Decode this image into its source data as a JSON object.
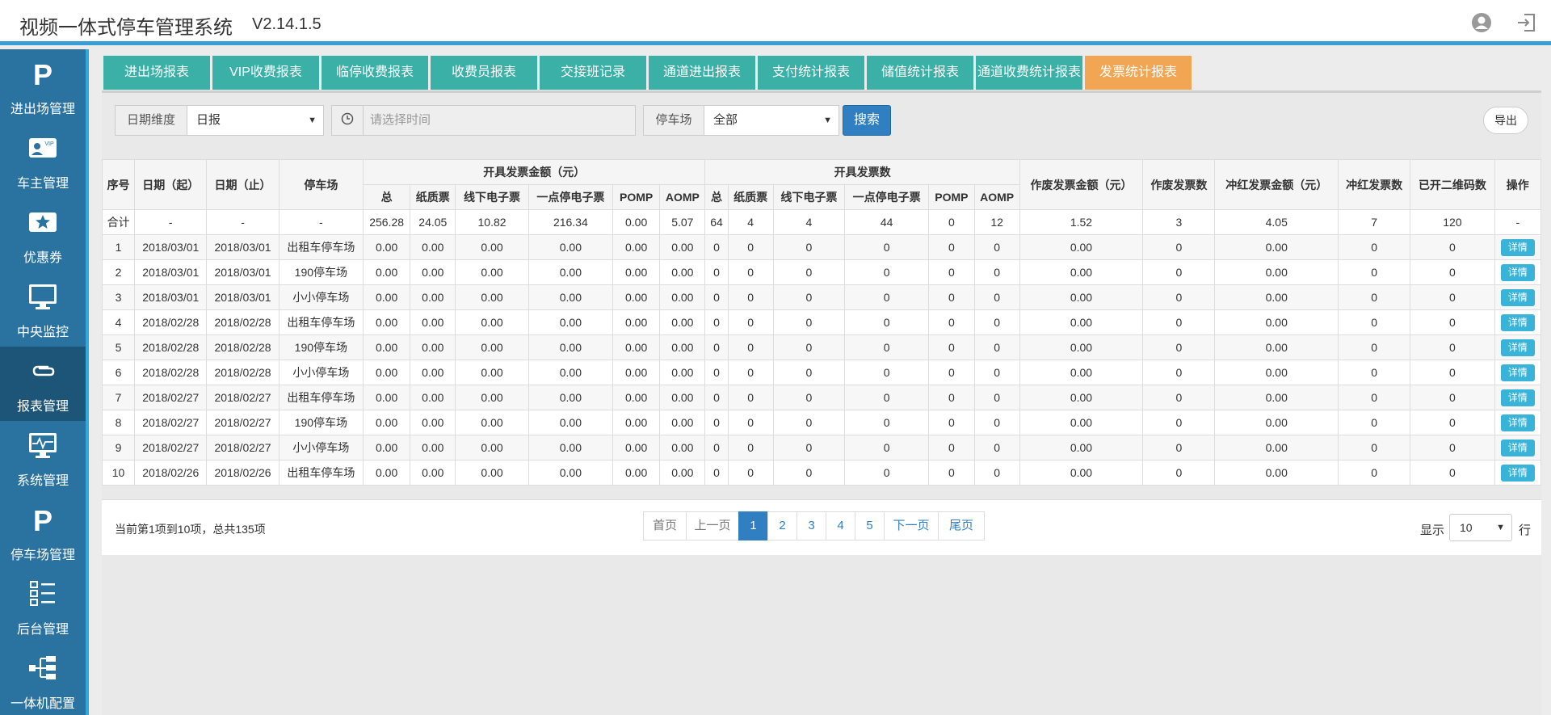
{
  "app": {
    "title": "视频一体式停车管理系统",
    "version": "V2.14.1.5"
  },
  "sidebar": {
    "items": [
      {
        "label": "进出场管理",
        "icon": "parking-icon"
      },
      {
        "label": "车主管理",
        "icon": "vip-card-icon"
      },
      {
        "label": "优惠券",
        "icon": "coupon-icon"
      },
      {
        "label": "中央监控",
        "icon": "monitor-icon"
      },
      {
        "label": "报表管理",
        "icon": "paperclip-icon",
        "active": true
      },
      {
        "label": "系统管理",
        "icon": "system-monitor-icon"
      },
      {
        "label": "停车场管理",
        "icon": "parking-icon"
      },
      {
        "label": "后台管理",
        "icon": "list-icon"
      },
      {
        "label": "一体机配置",
        "icon": "network-icon"
      }
    ]
  },
  "tabs": [
    {
      "label": "进出场报表"
    },
    {
      "label": "VIP收费报表"
    },
    {
      "label": "临停收费报表"
    },
    {
      "label": "收费员报表"
    },
    {
      "label": "交接班记录"
    },
    {
      "label": "通道进出报表"
    },
    {
      "label": "支付统计报表"
    },
    {
      "label": "储值统计报表"
    },
    {
      "label": "通道收费统计报表"
    },
    {
      "label": "发票统计报表",
      "active": true
    }
  ],
  "filters": {
    "date_dim_label": "日期维度",
    "date_dim_value": "日报",
    "time_placeholder": "请选择时间",
    "lot_label": "停车场",
    "lot_value": "全部",
    "search_label": "搜索",
    "export_label": "导出"
  },
  "table": {
    "headers": {
      "index": "序号",
      "date_start": "日期（起）",
      "date_end": "日期（止）",
      "lot": "停车场",
      "amount_group": "开具发票金额（元）",
      "count_group": "开具发票数",
      "void_amount": "作废发票金额（元）",
      "void_count": "作废发票数",
      "red_amount": "冲红发票金额（元）",
      "red_count": "冲红发票数",
      "qr_count": "已开二维码数",
      "action": "操作"
    },
    "sub_headers": [
      "总",
      "纸质票",
      "线下电子票",
      "一点停电子票",
      "POMP",
      "AOMP"
    ],
    "total_row": [
      "合计",
      "-",
      "-",
      "-",
      "256.28",
      "24.05",
      "10.82",
      "216.34",
      "0.00",
      "5.07",
      "64",
      "4",
      "4",
      "44",
      "0",
      "12",
      "1.52",
      "3",
      "4.05",
      "7",
      "120",
      "-"
    ],
    "rows": [
      [
        "1",
        "2018/03/01",
        "2018/03/01",
        "出租车停车场",
        "0.00",
        "0.00",
        "0.00",
        "0.00",
        "0.00",
        "0.00",
        "0",
        "0",
        "0",
        "0",
        "0",
        "0",
        "0.00",
        "0",
        "0.00",
        "0",
        "0"
      ],
      [
        "2",
        "2018/03/01",
        "2018/03/01",
        "190停车场",
        "0.00",
        "0.00",
        "0.00",
        "0.00",
        "0.00",
        "0.00",
        "0",
        "0",
        "0",
        "0",
        "0",
        "0",
        "0.00",
        "0",
        "0.00",
        "0",
        "0"
      ],
      [
        "3",
        "2018/03/01",
        "2018/03/01",
        "小小停车场",
        "0.00",
        "0.00",
        "0.00",
        "0.00",
        "0.00",
        "0.00",
        "0",
        "0",
        "0",
        "0",
        "0",
        "0",
        "0.00",
        "0",
        "0.00",
        "0",
        "0"
      ],
      [
        "4",
        "2018/02/28",
        "2018/02/28",
        "出租车停车场",
        "0.00",
        "0.00",
        "0.00",
        "0.00",
        "0.00",
        "0.00",
        "0",
        "0",
        "0",
        "0",
        "0",
        "0",
        "0.00",
        "0",
        "0.00",
        "0",
        "0"
      ],
      [
        "5",
        "2018/02/28",
        "2018/02/28",
        "190停车场",
        "0.00",
        "0.00",
        "0.00",
        "0.00",
        "0.00",
        "0.00",
        "0",
        "0",
        "0",
        "0",
        "0",
        "0",
        "0.00",
        "0",
        "0.00",
        "0",
        "0"
      ],
      [
        "6",
        "2018/02/28",
        "2018/02/28",
        "小小停车场",
        "0.00",
        "0.00",
        "0.00",
        "0.00",
        "0.00",
        "0.00",
        "0",
        "0",
        "0",
        "0",
        "0",
        "0",
        "0.00",
        "0",
        "0.00",
        "0",
        "0"
      ],
      [
        "7",
        "2018/02/27",
        "2018/02/27",
        "出租车停车场",
        "0.00",
        "0.00",
        "0.00",
        "0.00",
        "0.00",
        "0.00",
        "0",
        "0",
        "0",
        "0",
        "0",
        "0",
        "0.00",
        "0",
        "0.00",
        "0",
        "0"
      ],
      [
        "8",
        "2018/02/27",
        "2018/02/27",
        "190停车场",
        "0.00",
        "0.00",
        "0.00",
        "0.00",
        "0.00",
        "0.00",
        "0",
        "0",
        "0",
        "0",
        "0",
        "0",
        "0.00",
        "0",
        "0.00",
        "0",
        "0"
      ],
      [
        "9",
        "2018/02/27",
        "2018/02/27",
        "小小停车场",
        "0.00",
        "0.00",
        "0.00",
        "0.00",
        "0.00",
        "0.00",
        "0",
        "0",
        "0",
        "0",
        "0",
        "0",
        "0.00",
        "0",
        "0.00",
        "0",
        "0"
      ],
      [
        "10",
        "2018/02/26",
        "2018/02/26",
        "出租车停车场",
        "0.00",
        "0.00",
        "0.00",
        "0.00",
        "0.00",
        "0.00",
        "0",
        "0",
        "0",
        "0",
        "0",
        "0",
        "0.00",
        "0",
        "0.00",
        "0",
        "0"
      ]
    ],
    "detail_label": "详情"
  },
  "footer": {
    "info": "当前第1项到10项，总共135项",
    "pager": {
      "first": "首页",
      "prev": "上一页",
      "pages": [
        "1",
        "2",
        "3",
        "4",
        "5"
      ],
      "current": "1",
      "next": "下一页",
      "last": "尾页"
    },
    "show_label": "显示",
    "page_size": "10",
    "row_label": "行"
  },
  "colors": {
    "header_accent": "#3a9ed6",
    "sidebar_bg": "#2a73a0",
    "sidebar_active": "#1d5578",
    "tab_bg": "#3ab0a7",
    "tab_active": "#f2a654",
    "primary": "#2f7fc1",
    "detail_btn": "#39b3d7"
  }
}
